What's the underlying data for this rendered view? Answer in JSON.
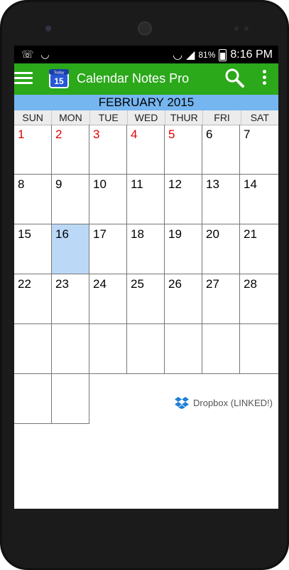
{
  "status": {
    "battery": "81%",
    "time": "8:16 PM"
  },
  "app": {
    "title": "Calendar Notes Pro",
    "icon_text": "15",
    "icon_caption": "Today"
  },
  "calendar": {
    "month_label": "FEBRUARY 2015",
    "weekdays": [
      "SUN",
      "MON",
      "TUE",
      "WED",
      "THUR",
      "FRI",
      "SAT"
    ],
    "weeks": [
      [
        "1",
        "2",
        "3",
        "4",
        "5",
        "6",
        "7"
      ],
      [
        "8",
        "9",
        "10",
        "11",
        "12",
        "13",
        "14"
      ],
      [
        "15",
        "16",
        "17",
        "18",
        "19",
        "20",
        "21"
      ],
      [
        "22",
        "23",
        "24",
        "25",
        "26",
        "27",
        "28"
      ],
      [
        "",
        "",
        "",
        "",
        "",
        "",
        ""
      ]
    ],
    "selected_day": "16",
    "red_days": [
      "1",
      "2",
      "3",
      "4",
      "5"
    ]
  },
  "footer": {
    "dropbox_label": "Dropbox (LINKED!)"
  },
  "colors": {
    "appbar": "#2ca81b",
    "monthbar": "#75b6f0",
    "selected": "#bcd8f7",
    "red": "#e00000"
  }
}
